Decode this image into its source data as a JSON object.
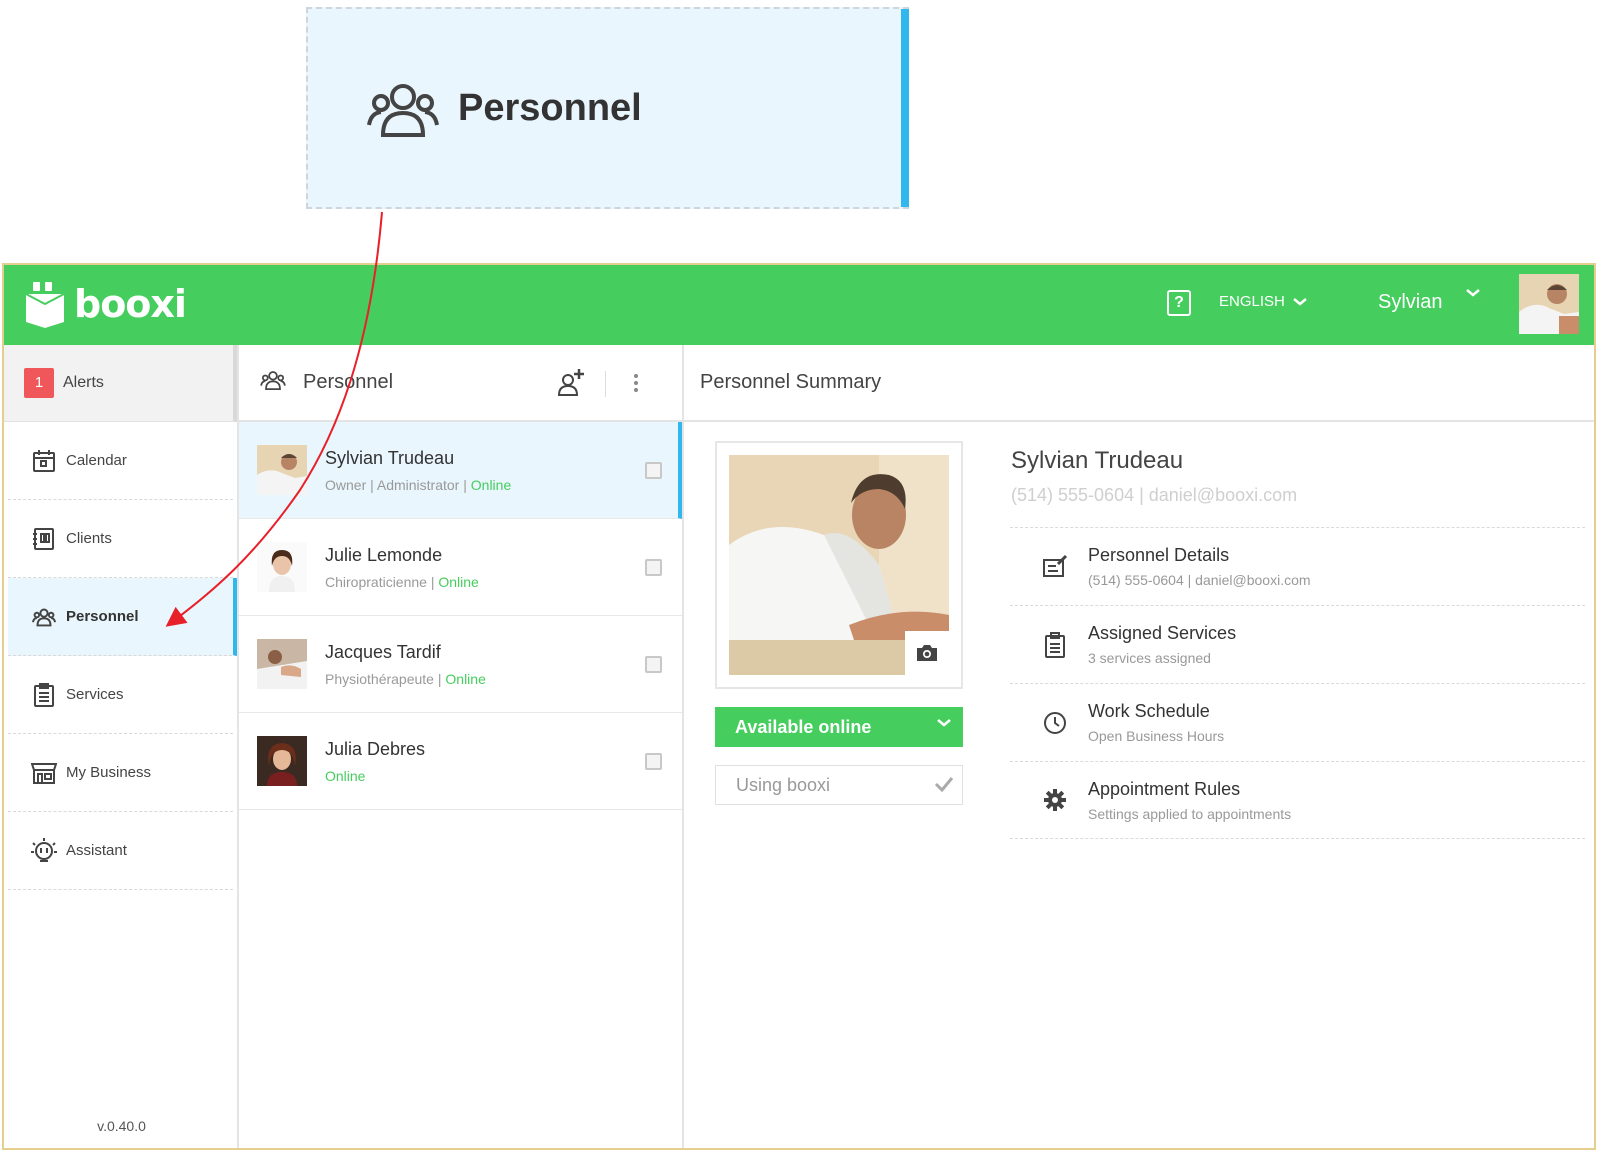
{
  "callout": {
    "label": "Personnel"
  },
  "header": {
    "brand": "booxi",
    "help": "?",
    "language": "ENGLISH",
    "user": "Sylvian",
    "accent": "#45cd5e"
  },
  "sidebar": {
    "alerts": {
      "count": "1",
      "label": "Alerts"
    },
    "items": [
      {
        "label": "Calendar",
        "icon": "calendar-icon"
      },
      {
        "label": "Clients",
        "icon": "clients-icon"
      },
      {
        "label": "Personnel",
        "icon": "personnel-icon",
        "active": true
      },
      {
        "label": "Services",
        "icon": "clipboard-icon"
      },
      {
        "label": "My Business",
        "icon": "store-icon"
      },
      {
        "label": "Assistant",
        "icon": "assistant-icon"
      }
    ],
    "version": "v.0.40.0"
  },
  "list": {
    "title": "Personnel",
    "people": [
      {
        "name": "Sylvian Trudeau",
        "role": "Owner | Administrator |",
        "status": "Online",
        "selected": true
      },
      {
        "name": "Julie Lemonde",
        "role": "Chiropraticienne |",
        "status": "Online"
      },
      {
        "name": "Jacques Tardif",
        "role": "Physiothérapeute |",
        "status": "Online"
      },
      {
        "name": "Julia Debres",
        "role": "",
        "status": "Online"
      }
    ]
  },
  "summary": {
    "title": "Personnel Summary",
    "name": "Sylvian Trudeau",
    "contact": "(514) 555-0604 | daniel@booxi.com",
    "available": "Available online",
    "using": "Using booxi",
    "details": [
      {
        "title": "Personnel Details",
        "sub": "(514) 555-0604 | daniel@booxi.com",
        "icon": "edit-icon"
      },
      {
        "title": "Assigned Services",
        "sub": "3 services assigned",
        "icon": "clipboard-icon"
      },
      {
        "title": "Work Schedule",
        "sub": "Open Business Hours",
        "icon": "clock-icon"
      },
      {
        "title": "Appointment Rules",
        "sub": "Settings applied to appointments",
        "icon": "gear-icon"
      }
    ]
  }
}
